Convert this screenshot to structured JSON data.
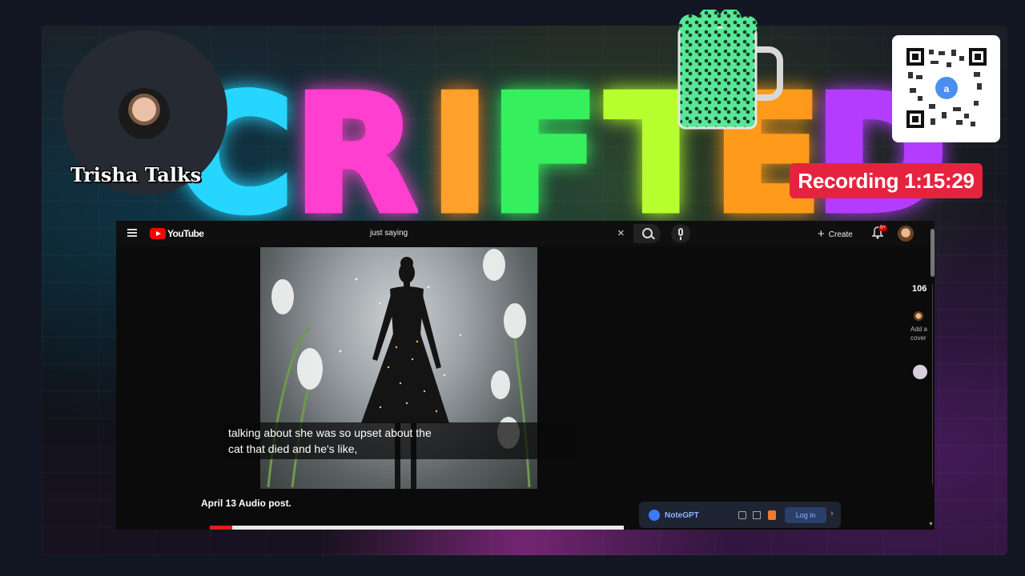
{
  "overlay": {
    "streamer_name": "Trisha Talks",
    "recording_text": "Recording 1:15:29",
    "neon_sign_letters": [
      "C",
      "R",
      "I",
      "F",
      "T",
      "E",
      "D"
    ],
    "colors": {
      "recording_badge": "#e5233f",
      "background": "#121723"
    },
    "icons": [
      "qr-code-icon",
      "beer-mug-icon",
      "streamer-avatar"
    ]
  },
  "youtube": {
    "brand": "YouTube",
    "search_value": "just saying",
    "create_label": "Create",
    "notification_badge": "9+",
    "caption_line1": "talking about she was so upset about the",
    "caption_line2": "cat that died and he's like,",
    "video_title": "April 13 Audio post.",
    "progress_fraction": 0.055,
    "side_count": "106",
    "side_add_label": "Add a cover",
    "icons": [
      "menu-icon",
      "close-icon",
      "search-icon",
      "mic-icon",
      "plus-icon",
      "bell-icon",
      "avatar"
    ]
  },
  "notegpt": {
    "name": "NoteGPT",
    "login_label": "Log in",
    "accent": "#3a7bff"
  }
}
